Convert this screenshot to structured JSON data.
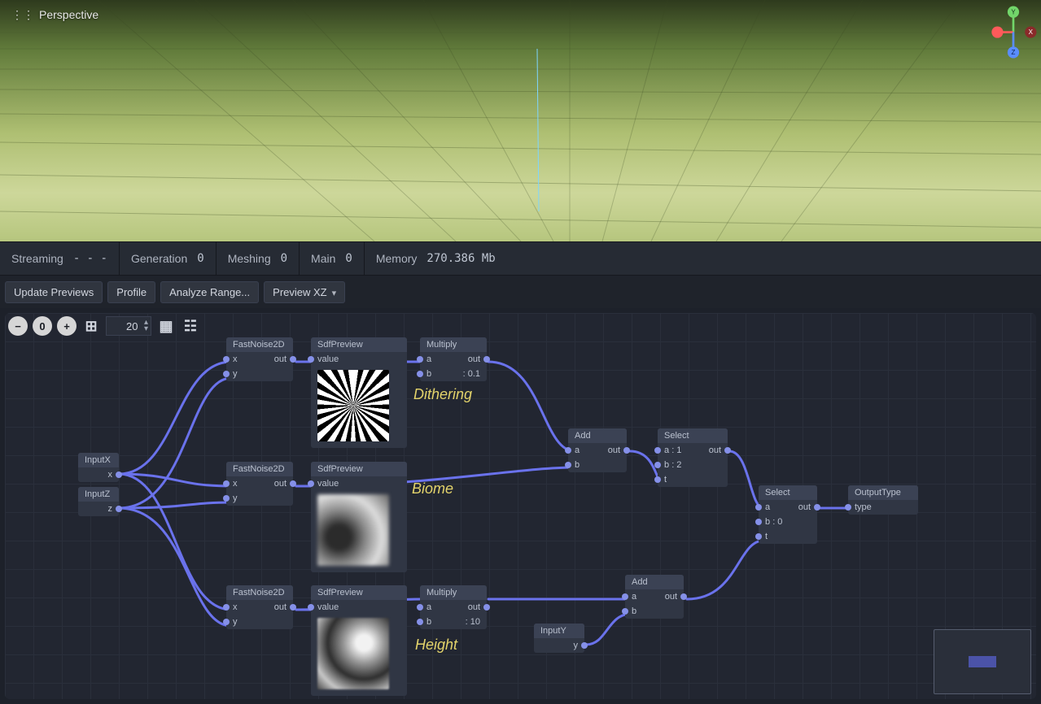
{
  "viewport": {
    "mode": "Perspective",
    "axis_labels": {
      "x": "X",
      "y": "Y",
      "z": "Z"
    }
  },
  "status": {
    "streaming": {
      "label": "Streaming",
      "value": "- - -"
    },
    "generation": {
      "label": "Generation",
      "value": "0"
    },
    "meshing": {
      "label": "Meshing",
      "value": "0"
    },
    "main": {
      "label": "Main",
      "value": "0"
    },
    "memory": {
      "label": "Memory",
      "value": "270.386 Mb"
    }
  },
  "toolbar": {
    "update_previews": "Update Previews",
    "profile": "Profile",
    "analyze_range": "Analyze Range...",
    "preview_plane": "Preview XZ"
  },
  "zoom": {
    "value": "20"
  },
  "annotations": {
    "dithering": "Dithering",
    "biome": "Biome",
    "height": "Height"
  },
  "nodes": {
    "input_x": {
      "title": "InputX",
      "outputs": [
        "x"
      ]
    },
    "input_z": {
      "title": "InputZ",
      "outputs": [
        "z"
      ]
    },
    "input_y": {
      "title": "InputY",
      "outputs": [
        "y"
      ]
    },
    "noise1": {
      "title": "FastNoise2D",
      "inputs": [
        "x",
        "y"
      ],
      "outputs": [
        "out"
      ]
    },
    "noise2": {
      "title": "FastNoise2D",
      "inputs": [
        "x",
        "y"
      ],
      "outputs": [
        "out"
      ]
    },
    "noise3": {
      "title": "FastNoise2D",
      "inputs": [
        "x",
        "y"
      ],
      "outputs": [
        "out"
      ]
    },
    "preview1": {
      "title": "SdfPreview",
      "inputs": [
        "value"
      ]
    },
    "preview2": {
      "title": "SdfPreview",
      "inputs": [
        "value"
      ]
    },
    "preview3": {
      "title": "SdfPreview",
      "inputs": [
        "value"
      ]
    },
    "multiply1": {
      "title": "Multiply",
      "rows": [
        {
          "l": "a",
          "r": "out"
        },
        {
          "l": "b",
          "r": ": 0.1"
        }
      ]
    },
    "multiply2": {
      "title": "Multiply",
      "rows": [
        {
          "l": "a",
          "r": "out"
        },
        {
          "l": "b",
          "r": ": 10"
        }
      ]
    },
    "add1": {
      "title": "Add",
      "rows": [
        {
          "l": "a",
          "r": "out"
        },
        {
          "l": "b",
          "r": ""
        }
      ]
    },
    "add2": {
      "title": "Add",
      "rows": [
        {
          "l": "a",
          "r": "out"
        },
        {
          "l": "b",
          "r": ""
        }
      ]
    },
    "select1": {
      "title": "Select",
      "rows": [
        {
          "l": "a",
          "la": ": 1",
          "r": "out"
        },
        {
          "l": "b",
          "la": ": 2",
          "r": ""
        },
        {
          "l": "t",
          "la": "",
          "r": ""
        }
      ]
    },
    "select2": {
      "title": "Select",
      "rows": [
        {
          "l": "a",
          "la": "",
          "r": "out"
        },
        {
          "l": "b",
          "la": ": 0",
          "r": ""
        },
        {
          "l": "t",
          "la": "",
          "r": ""
        }
      ]
    },
    "output": {
      "title": "OutputType",
      "inputs": [
        "type"
      ]
    }
  }
}
